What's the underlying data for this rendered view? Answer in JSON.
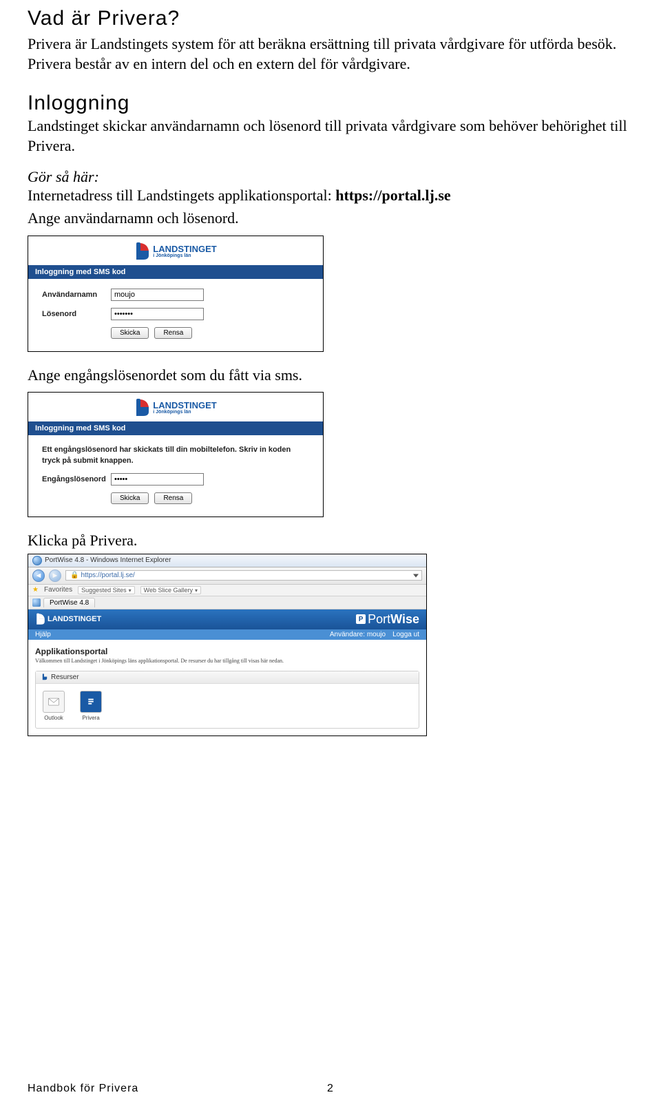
{
  "title1": "Vad är Privera?",
  "intro1": "Privera är Landstingets system för att beräkna ersättning till privata vårdgivare för utförda besök. Privera består av en intern del och en extern del för vårdgivare.",
  "title2": "Inloggning",
  "intro2": "Landstinget skickar användarnamn och lösenord till privata vårdgivare som behöver behörighet till Privera.",
  "howto_lead": "Gör så här:",
  "howto_line1a": "Internetadress till Landstingets applikationsportal: ",
  "howto_line1b": "https://portal.lj.se",
  "howto_line2": "Ange användarnamn och lösenord.",
  "between_text": "Ange engångslösenordet som du fått via sms.",
  "click_privera": "Klicka på Privera.",
  "logo": {
    "main": "LANDSTINGET",
    "sub": "i Jönköpings län"
  },
  "dialog1": {
    "bar": "Inloggning med SMS kod",
    "user_label": "Användarnamn",
    "user_value": "moujo",
    "pass_label": "Lösenord",
    "pass_value": "•••••••",
    "btn_submit": "Skicka",
    "btn_reset": "Rensa"
  },
  "dialog2": {
    "bar": "Inloggning med SMS kod",
    "info": "Ett engångslösenord har skickats till din mobiltelefon. Skriv in koden tryck på submit knappen.",
    "otp_label": "Engångslösenord",
    "otp_value": "•••••",
    "btn_submit": "Skicka",
    "btn_reset": "Rensa"
  },
  "browser": {
    "title": "PortWise 4.8 - Windows Internet Explorer",
    "url": "https://portal.lj.se/",
    "fav_label": "Favorites",
    "suggested": "Suggested Sites",
    "webslice": "Web Slice Gallery",
    "tab": "PortWise 4.8",
    "brand": {
      "port": "Port",
      "wise": "Wise"
    },
    "menu_left": "Hjälp",
    "menu_user_label": "Användare:",
    "menu_user_value": "moujo",
    "menu_logout": "Logga ut",
    "panel_title": "Applikationsportal",
    "panel_sub": "Välkommen till Landstinget i Jönköpings läns applikationsportal. De resurser du har tillgång till visas här nedan.",
    "resources_title": "Resurser",
    "apps": {
      "outlook": "Outlook",
      "privera": "Privera"
    }
  },
  "footer_left": "Handbok för Privera",
  "footer_page": "2"
}
